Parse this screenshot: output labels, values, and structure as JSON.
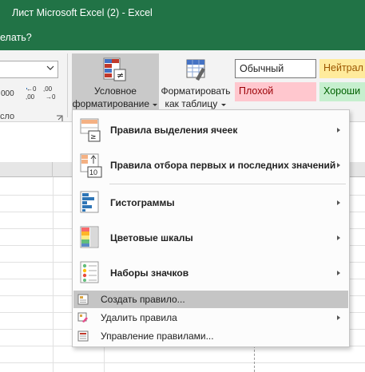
{
  "window": {
    "title": "Лист Microsoft Excel (2)  -  Excel",
    "tell_me": "елать?"
  },
  "ribbon": {
    "number_group": {
      "format_value": "",
      "thousands_label": "000",
      "increase_decimal_label": ",0 ,00",
      "decrease_decimal_label": ",00 ,0",
      "group_label": "сло"
    },
    "conditional_formatting": {
      "line1": "Условное",
      "line2": "форматирование"
    },
    "format_as_table": {
      "line1": "Форматировать",
      "line2": "как таблицу"
    },
    "styles": {
      "normal": "Обычный",
      "neutral": "Нейтрал",
      "bad": "Плохой",
      "good": "Хороши"
    }
  },
  "sheet": {
    "column_header": "N"
  },
  "menu": {
    "highlight_rules": "Правила выделения ячеек",
    "top_bottom_rules": "Правила отбора первых и последних значений",
    "data_bars": "Гистограммы",
    "color_scales": "Цветовые шкалы",
    "icon_sets": "Наборы значков",
    "new_rule": "Создать правило...",
    "clear_rules": "Удалить правила",
    "manage_rules": "Управление правилами..."
  },
  "colors": {
    "excel_green": "#217346",
    "normal_fill": "#ffffff",
    "neutral_fill": "#ffeb9c",
    "bad_fill": "#ffc7ce",
    "good_fill": "#c6efce",
    "menu_highlight": "#c5c5c5",
    "button_pressed": "#c9c9c9"
  }
}
